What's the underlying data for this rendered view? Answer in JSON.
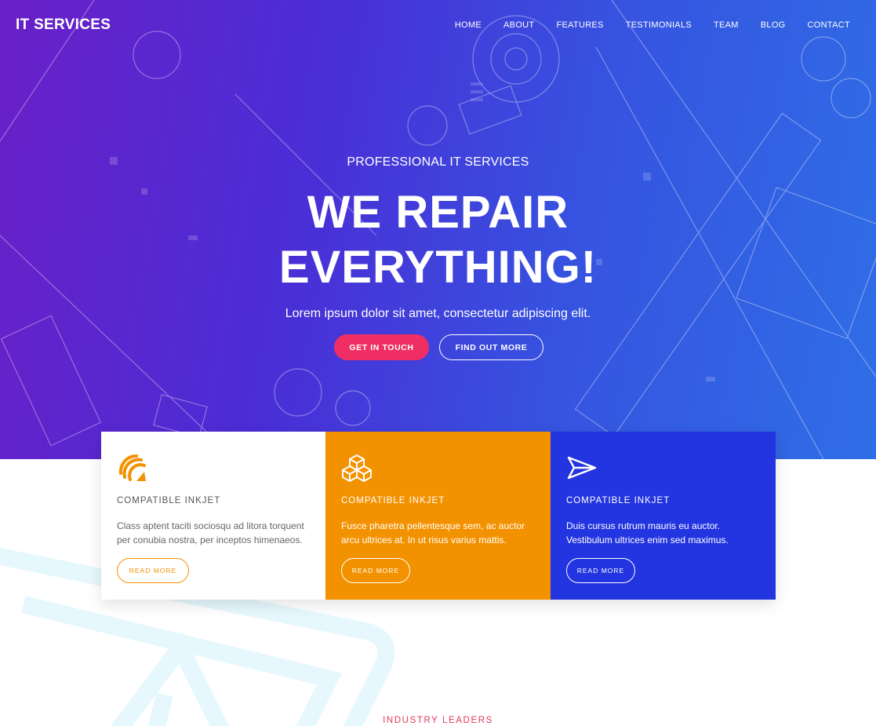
{
  "brand": {
    "logo": "IT SERVICES"
  },
  "nav": {
    "items": [
      "HOME",
      "ABOUT",
      "FEATURES",
      "TESTIMONIALS",
      "TEAM",
      "BLOG",
      "CONTACT"
    ]
  },
  "hero": {
    "eyebrow": "PROFESSIONAL IT SERVICES",
    "headline_line1": "WE REPAIR",
    "headline_line2": "EVERYTHING!",
    "subtext": "Lorem ipsum dolor sit amet, consectetur adipiscing elit.",
    "primary_button": "GET IN TOUCH",
    "secondary_button": "FIND OUT MORE"
  },
  "cards": [
    {
      "icon": "signal-wave-icon",
      "title": "COMPATIBLE INKJET",
      "text": "Class aptent taciti sociosqu ad litora torquent per conubia nostra, per inceptos himenaeos.",
      "button": "READ MORE"
    },
    {
      "icon": "boxes-icon",
      "title": "COMPATIBLE INKJET",
      "text": "Fusce pharetra pellentesque sem, ac auctor arcu ultrices at. In ut risus varius mattis.",
      "button": "READ MORE"
    },
    {
      "icon": "paper-plane-icon",
      "title": "COMPATIBLE INKJET",
      "text": "Duis cursus rutrum mauris eu auctor. Vestibulum ultrices enim sed maximus.",
      "button": "READ MORE"
    }
  ],
  "section": {
    "eyebrow": "INDUSTRY LEADERS"
  },
  "colors": {
    "accent_pink": "#ef2f63",
    "orange": "#f39200",
    "blue": "#2335e0",
    "hero_gradient_start": "#6a1fc7",
    "hero_gradient_end": "#2f6ee6"
  }
}
